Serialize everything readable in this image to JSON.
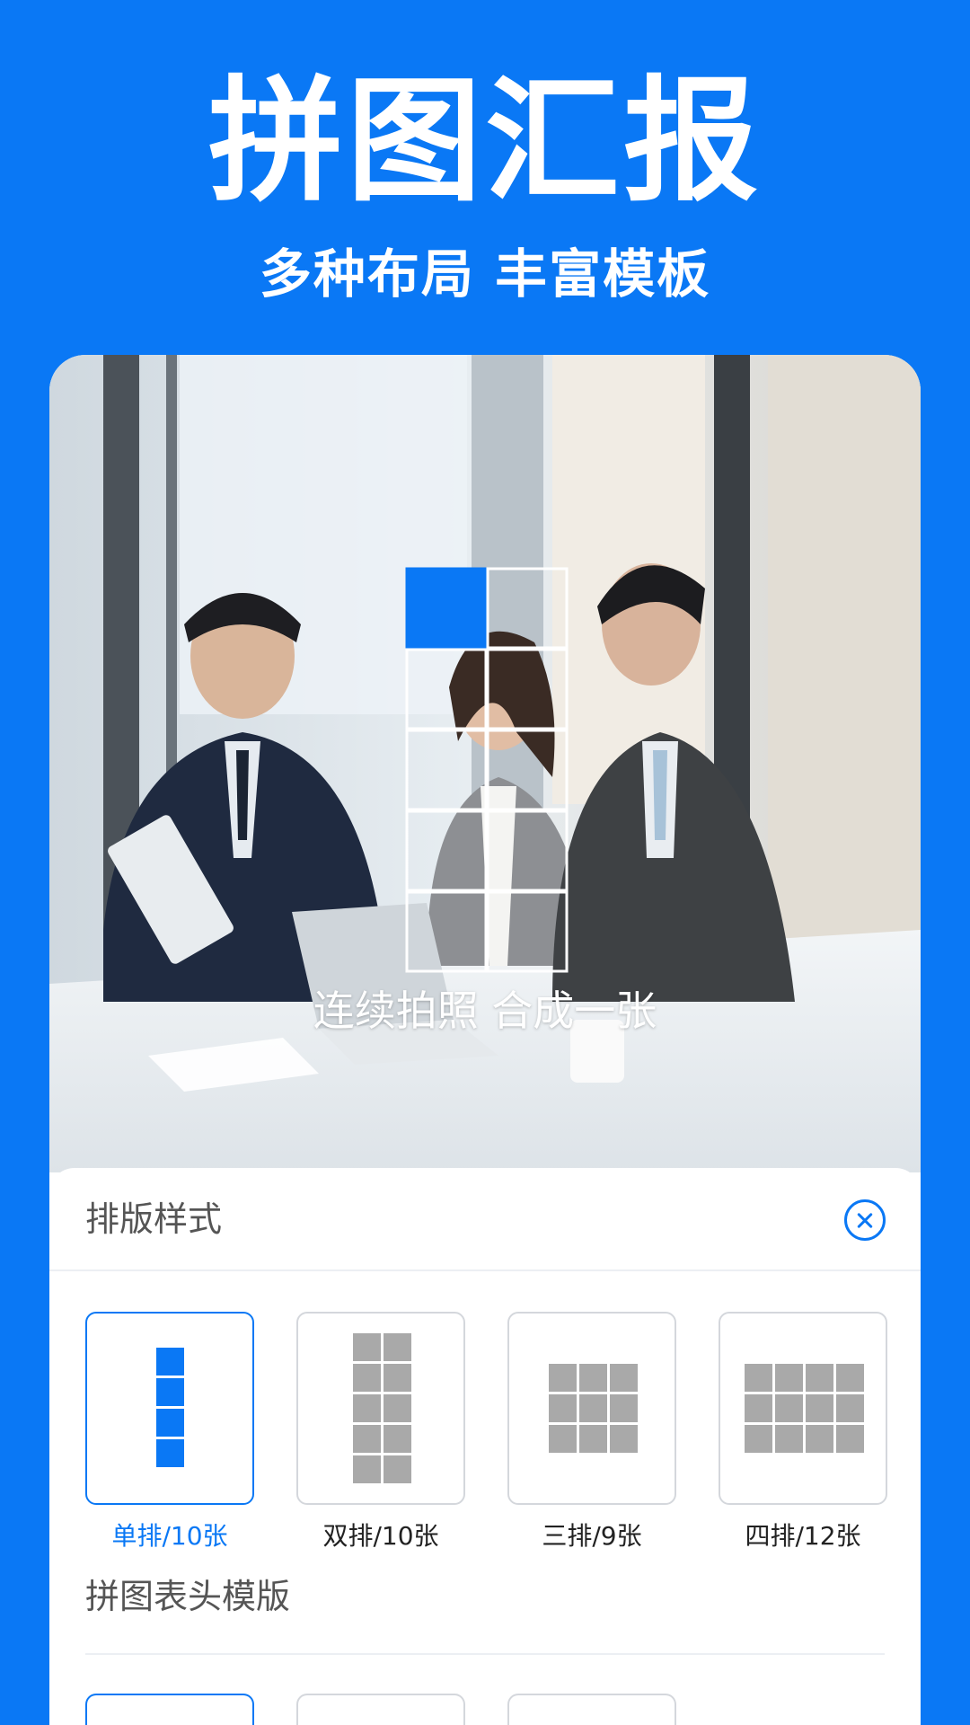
{
  "hero": {
    "title": "拼图汇报",
    "subtitle": "多种布局 丰富模板"
  },
  "photo": {
    "caption": "连续拍照 合成一张",
    "overlay_icon": "photo-grid-icon"
  },
  "panel": {
    "title": "排版样式",
    "close_icon": "close-circle-icon",
    "layouts": [
      {
        "label": "单排/10张",
        "selected": true
      },
      {
        "label": "双排/10张",
        "selected": false
      },
      {
        "label": "三排/9张",
        "selected": false
      },
      {
        "label": "四排/12张",
        "selected": false
      }
    ],
    "template_title": "拼图表头模版"
  },
  "colors": {
    "accent": "#0a78f5",
    "background": "#0a78f5",
    "inactive_icon": "#a9a9a9"
  }
}
